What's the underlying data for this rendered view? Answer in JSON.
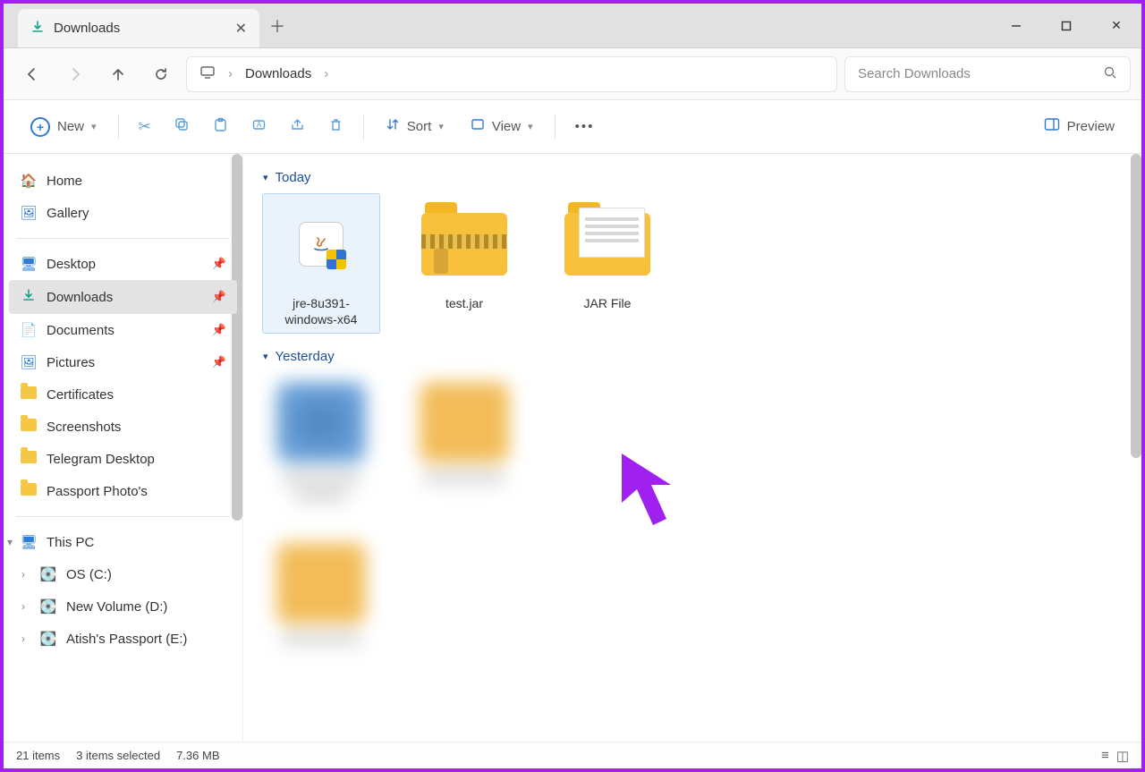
{
  "tab": {
    "title": "Downloads"
  },
  "breadcrumb": {
    "current": "Downloads"
  },
  "search": {
    "placeholder": "Search Downloads"
  },
  "toolbar": {
    "new_label": "New",
    "sort_label": "Sort",
    "view_label": "View",
    "preview_label": "Preview"
  },
  "sidebar": {
    "home": "Home",
    "gallery": "Gallery",
    "quick": [
      {
        "label": "Desktop",
        "pinned": true,
        "icon": "desktop"
      },
      {
        "label": "Downloads",
        "pinned": true,
        "icon": "download",
        "selected": true
      },
      {
        "label": "Documents",
        "pinned": true,
        "icon": "document"
      },
      {
        "label": "Pictures",
        "pinned": true,
        "icon": "picture"
      },
      {
        "label": "Certificates",
        "pinned": false,
        "icon": "folder"
      },
      {
        "label": "Screenshots",
        "pinned": false,
        "icon": "folder"
      },
      {
        "label": "Telegram Desktop",
        "pinned": false,
        "icon": "folder"
      },
      {
        "label": "Passport Photo's",
        "pinned": false,
        "icon": "folder"
      }
    ],
    "this_pc": "This PC",
    "drives": [
      {
        "label": "OS (C:)"
      },
      {
        "label": "New Volume (D:)"
      },
      {
        "label": "Atish's Passport  (E:)"
      }
    ]
  },
  "groups": {
    "today": {
      "label": "Today",
      "items": [
        {
          "name": "jre-8u391-windows-x64",
          "type": "exe",
          "selected": true
        },
        {
          "name": "test.jar",
          "type": "zip"
        },
        {
          "name": "JAR File",
          "type": "docfolder"
        }
      ]
    },
    "yesterday": {
      "label": "Yesterday"
    }
  },
  "status": {
    "count": "21 items",
    "selection": "3 items selected",
    "size": "7.36 MB"
  }
}
